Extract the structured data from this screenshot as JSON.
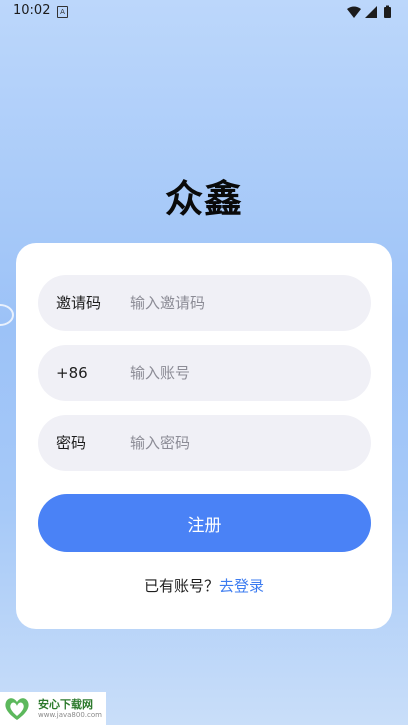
{
  "status_bar": {
    "time": "10:02",
    "notification_glyph": "A"
  },
  "app": {
    "title": "众鑫"
  },
  "form": {
    "invite": {
      "label": "邀请码",
      "placeholder": "输入邀请码"
    },
    "account": {
      "label": "+86",
      "placeholder": "输入账号"
    },
    "password": {
      "label": "密码",
      "placeholder": "输入密码"
    },
    "register_label": "注册",
    "have_account_text": "已有账号？",
    "login_link": "去登录"
  },
  "watermark": {
    "name": "安心下载网",
    "url": "www.java800.com"
  },
  "colors": {
    "primary": "#4a82f6",
    "link": "#3d7cf0",
    "field_bg": "#f0f0f6"
  }
}
